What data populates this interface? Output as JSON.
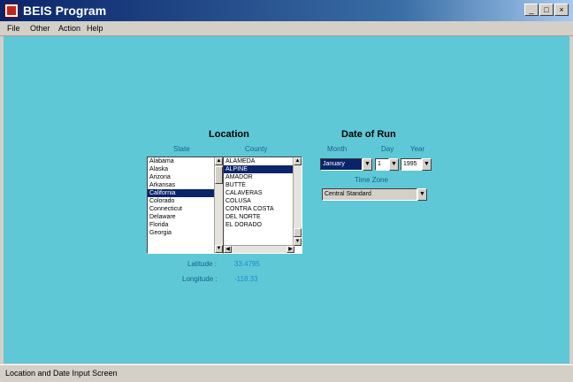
{
  "window": {
    "title": "BEIS Program"
  },
  "menu": [
    "File",
    "Other",
    "Action",
    "Help"
  ],
  "location": {
    "heading": "Location",
    "state_label": "State",
    "county_label": "County",
    "states": [
      "Alabama",
      "Alaska",
      "Arizona",
      "Arkansas",
      "California",
      "Colorado",
      "Connecticut",
      "Delaware",
      "Florida",
      "Georgia"
    ],
    "states_selected": 4,
    "counties": [
      "ALAMEDA",
      "ALPINE",
      "AMADOR",
      "BUTTE",
      "CALAVERAS",
      "COLUSA",
      "CONTRA COSTA",
      "DEL NORTE",
      "EL DORADO"
    ],
    "counties_selected": 1,
    "latitude_label": "Latitude :",
    "latitude_value": "33.4795",
    "longitude_label": "Longitude :",
    "longitude_value": "-118.33"
  },
  "date": {
    "heading": "Date of Run",
    "month_label": "Month",
    "day_label": "Day",
    "year_label": "Year",
    "month_value": "January",
    "day_value": "1",
    "year_value": "1995",
    "timezone_label": "Time Zone",
    "timezone_value": "Central Standard"
  },
  "status": "Location and Date Input Screen"
}
